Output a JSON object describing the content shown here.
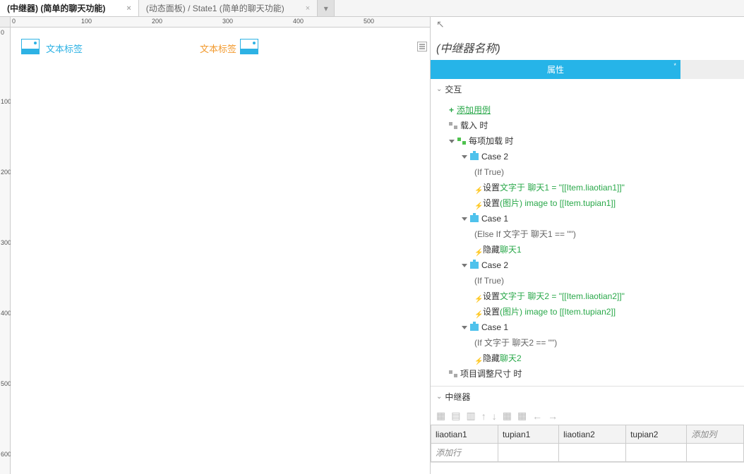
{
  "tabs": [
    {
      "label": "(中继器) (简单的聊天功能)",
      "active": true
    },
    {
      "label": "(动态面板) / State1 (简单的聊天功能)",
      "active": false
    }
  ],
  "ruler_marks": [
    "0",
    "100",
    "200",
    "300",
    "400",
    "500"
  ],
  "ruler_v_marks": [
    "0",
    "100",
    "200",
    "300",
    "400",
    "500",
    "600"
  ],
  "canvas": {
    "label1": "文本标签",
    "label2": "文本标签"
  },
  "inspector": {
    "title": "(中继器名称)",
    "prop_tab": "属性",
    "sections": {
      "interaction": "交互",
      "repeater": "中继器"
    },
    "add_case": "添加用例",
    "events": {
      "onload": "载入 时",
      "onitemload": "每项加载 时",
      "onresize": "项目调整尺寸 时"
    },
    "cases": {
      "c2a": {
        "name": "Case 2",
        "cond": "(If True)"
      },
      "c1a": {
        "name": "Case 1",
        "cond": "(Else If 文字于 聊天1 == \"\")"
      },
      "c2b": {
        "name": "Case 2",
        "cond": "(If True)"
      },
      "c1b": {
        "name": "Case 1",
        "cond": "(If 文字于 聊天2 == \"\")"
      }
    },
    "actions": {
      "a1_pre": "设置 ",
      "a1_link": "文字于 聊天1 = \"[[Item.liaotian1]]\"",
      "a2_pre": "设置 ",
      "a2_link": "(图片) image to [[Item.tupian1]]",
      "a3_pre": "隐藏 ",
      "a3_link": "聊天1",
      "a4_pre": "设置 ",
      "a4_link": "文字于 聊天2 = \"[[Item.liaotian2]]\"",
      "a5_pre": "设置 ",
      "a5_link": "(图片) image to [[Item.tupian2]]",
      "a6_pre": "隐藏 ",
      "a6_link": "聊天2"
    },
    "table": {
      "cols": [
        "liaotian1",
        "tupian1",
        "liaotian2",
        "tupian2"
      ],
      "addcol": "添加列",
      "addrow": "添加行"
    }
  }
}
